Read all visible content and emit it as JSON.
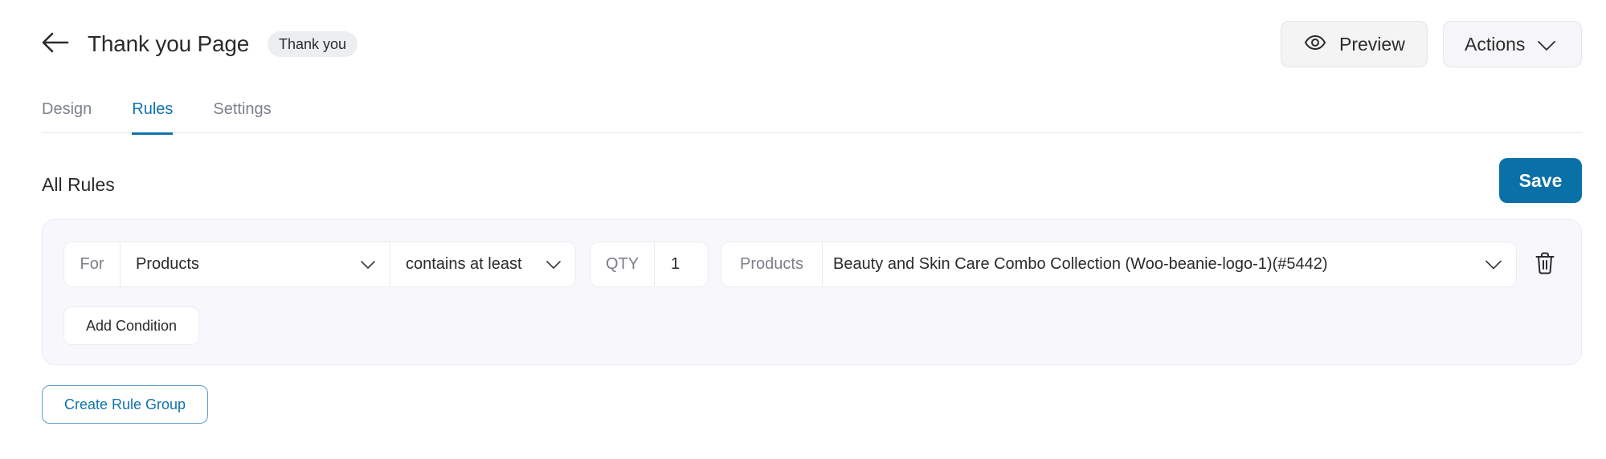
{
  "header": {
    "back_icon": "arrow-left-icon",
    "title": "Thank you Page",
    "badge": "Thank you",
    "preview_label": "Preview",
    "preview_icon": "eye-icon",
    "actions_label": "Actions",
    "actions_icon": "chevron-down-icon"
  },
  "tabs": [
    {
      "label": "Design",
      "active": false
    },
    {
      "label": "Rules",
      "active": true
    },
    {
      "label": "Settings",
      "active": false
    }
  ],
  "rules": {
    "heading": "All Rules",
    "save_label": "Save",
    "groups": [
      {
        "conditions": [
          {
            "for_label": "For",
            "for_value": "Products",
            "operator": "contains at least",
            "qty_label": "QTY",
            "qty_value": "1",
            "products_label": "Products",
            "products_value": "Beauty and Skin Care Combo Collection (Woo-beanie-logo-1)(#5442)",
            "delete_icon": "trash-icon"
          }
        ],
        "add_condition_label": "Add Condition"
      }
    ],
    "create_group_label": "Create Rule Group"
  },
  "colors": {
    "accent": "#0a70a8",
    "tab_active": "#1073aa",
    "group_bg": "#f8f8fc"
  }
}
